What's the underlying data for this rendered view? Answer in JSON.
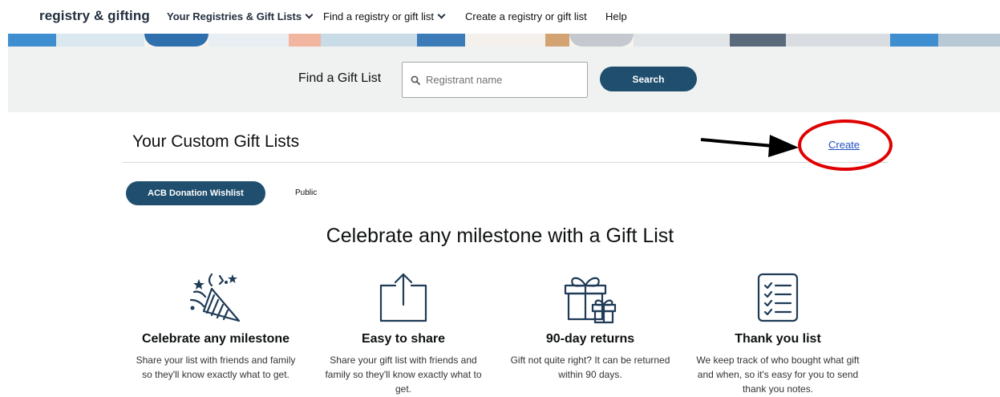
{
  "nav": {
    "brand": "registry & gifting",
    "items": [
      {
        "label": "Your Registries & Gift Lists",
        "has_dropdown": true
      },
      {
        "label": "Find a registry or gift list",
        "has_dropdown": true
      },
      {
        "label": "Create a registry or gift list",
        "has_dropdown": false
      },
      {
        "label": "Help",
        "has_dropdown": false
      }
    ]
  },
  "search": {
    "label": "Find a Gift List",
    "placeholder": "Registrant name",
    "value": "",
    "button_label": "Search",
    "icon": "search-icon"
  },
  "custom_lists": {
    "title": "Your Custom Gift Lists",
    "create_label": "Create",
    "lists": [
      {
        "label": "ACB Donation Wishlist",
        "visibility": "Public"
      }
    ]
  },
  "hero": {
    "title": "Celebrate any milestone with a Gift List"
  },
  "features": [
    {
      "icon": "party-hat-icon",
      "title": "Celebrate any milestone",
      "description": "Share your list with friends and family so they'll know exactly what to get."
    },
    {
      "icon": "share-icon",
      "title": "Easy to share",
      "description": "Share your gift list with friends and family so they'll know exactly what to get."
    },
    {
      "icon": "gift-box-icon",
      "title": "90-day returns",
      "description": "Gift not quite right? It can be returned within 90 days."
    },
    {
      "icon": "checklist-icon",
      "title": "Thank you list",
      "description": "We keep track of who bought what gift and when, so it's easy for you to send thank you notes."
    }
  ],
  "colors": {
    "brand_dark": "#232f3e",
    "button": "#1f4e6e",
    "link": "#1f4fbf",
    "annotation": "#e00000",
    "band": "#f0f2f2"
  }
}
